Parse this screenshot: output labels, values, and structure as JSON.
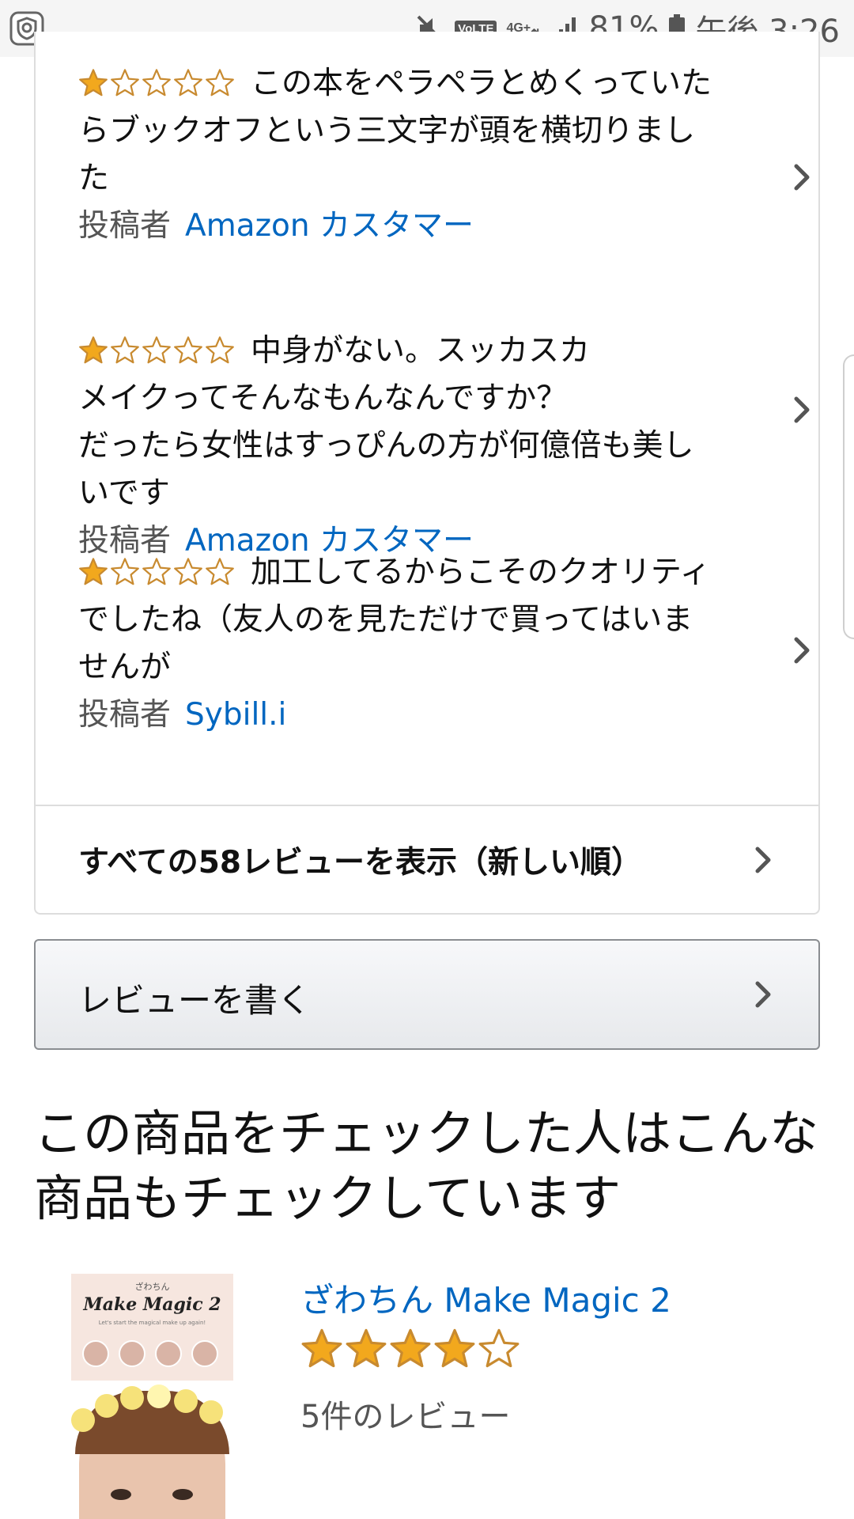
{
  "status_bar": {
    "battery_percent": "81%",
    "time": "午後 3:26",
    "volte_label": "VoLTE",
    "network_label": "4G+"
  },
  "reviews": [
    {
      "rating": 1,
      "text": "この本をペラペラとめくっていたらブックオフという三文字が頭を横切りました",
      "author_prefix": "投稿者",
      "author": "Amazon カスタマー"
    },
    {
      "rating": 1,
      "text": "中身がない。スッカスカ\nメイクってそんなもんなんですか？\nだったら女性はすっぴんの方が何億倍も美しいです",
      "author_prefix": "投稿者",
      "author": "Amazon カスタマー"
    },
    {
      "rating": 1,
      "text": "加工してるからこそのクオリティでしたね（友人のを見ただけで買ってはいませんが",
      "author_prefix": "投稿者",
      "author": "Sybill.i"
    }
  ],
  "see_all_label": "すべての58レビューを表示（新しい順）",
  "write_review_label": "レビューを書く",
  "recommendations": {
    "heading": "この商品をチェックした人はこんな商品もチェックしています",
    "items": [
      {
        "title": "ざわちん Make Magic 2",
        "rating": 4,
        "review_count": "5件のレビュー",
        "cover_series": "ざわちん",
        "cover_title": "Make Magic 2",
        "cover_subtitle": "Let's start the magical make up again!"
      }
    ]
  },
  "colors": {
    "link": "#0066c0",
    "star_fill": "#f2a81d",
    "star_outline": "#c88a2f",
    "muted_text": "#555555"
  }
}
